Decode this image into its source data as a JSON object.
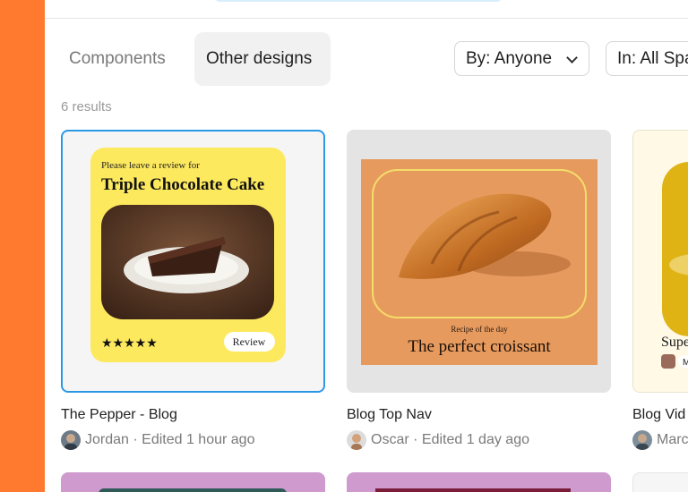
{
  "tabs": {
    "components": "Components",
    "other_designs": "Other designs"
  },
  "filters": {
    "by": "By: Anyone",
    "in": "In: All Spa"
  },
  "results_count": "6 results",
  "cards": [
    {
      "title": "The Pepper - Blog",
      "author": "Jordan",
      "edited": "· Edited 1 hour ago",
      "thumb": {
        "kicker": "Please leave a review for",
        "heading": "Triple Chocolate Cake",
        "button": "Review",
        "stars": "★★★★★"
      }
    },
    {
      "title": "Blog Top Nav",
      "author": "Oscar",
      "edited": "· Edited 1 day ago",
      "thumb": {
        "kicker": "Recipe of the day",
        "heading": "The perfect croissant"
      }
    },
    {
      "title": "Blog Vid",
      "author": "Marc",
      "thumb": {
        "heading": "Supe",
        "badge": "M"
      }
    }
  ],
  "colors": {
    "accent": "#ff7a2f",
    "selection": "#2b98e6",
    "yellow": "#fde95e"
  }
}
